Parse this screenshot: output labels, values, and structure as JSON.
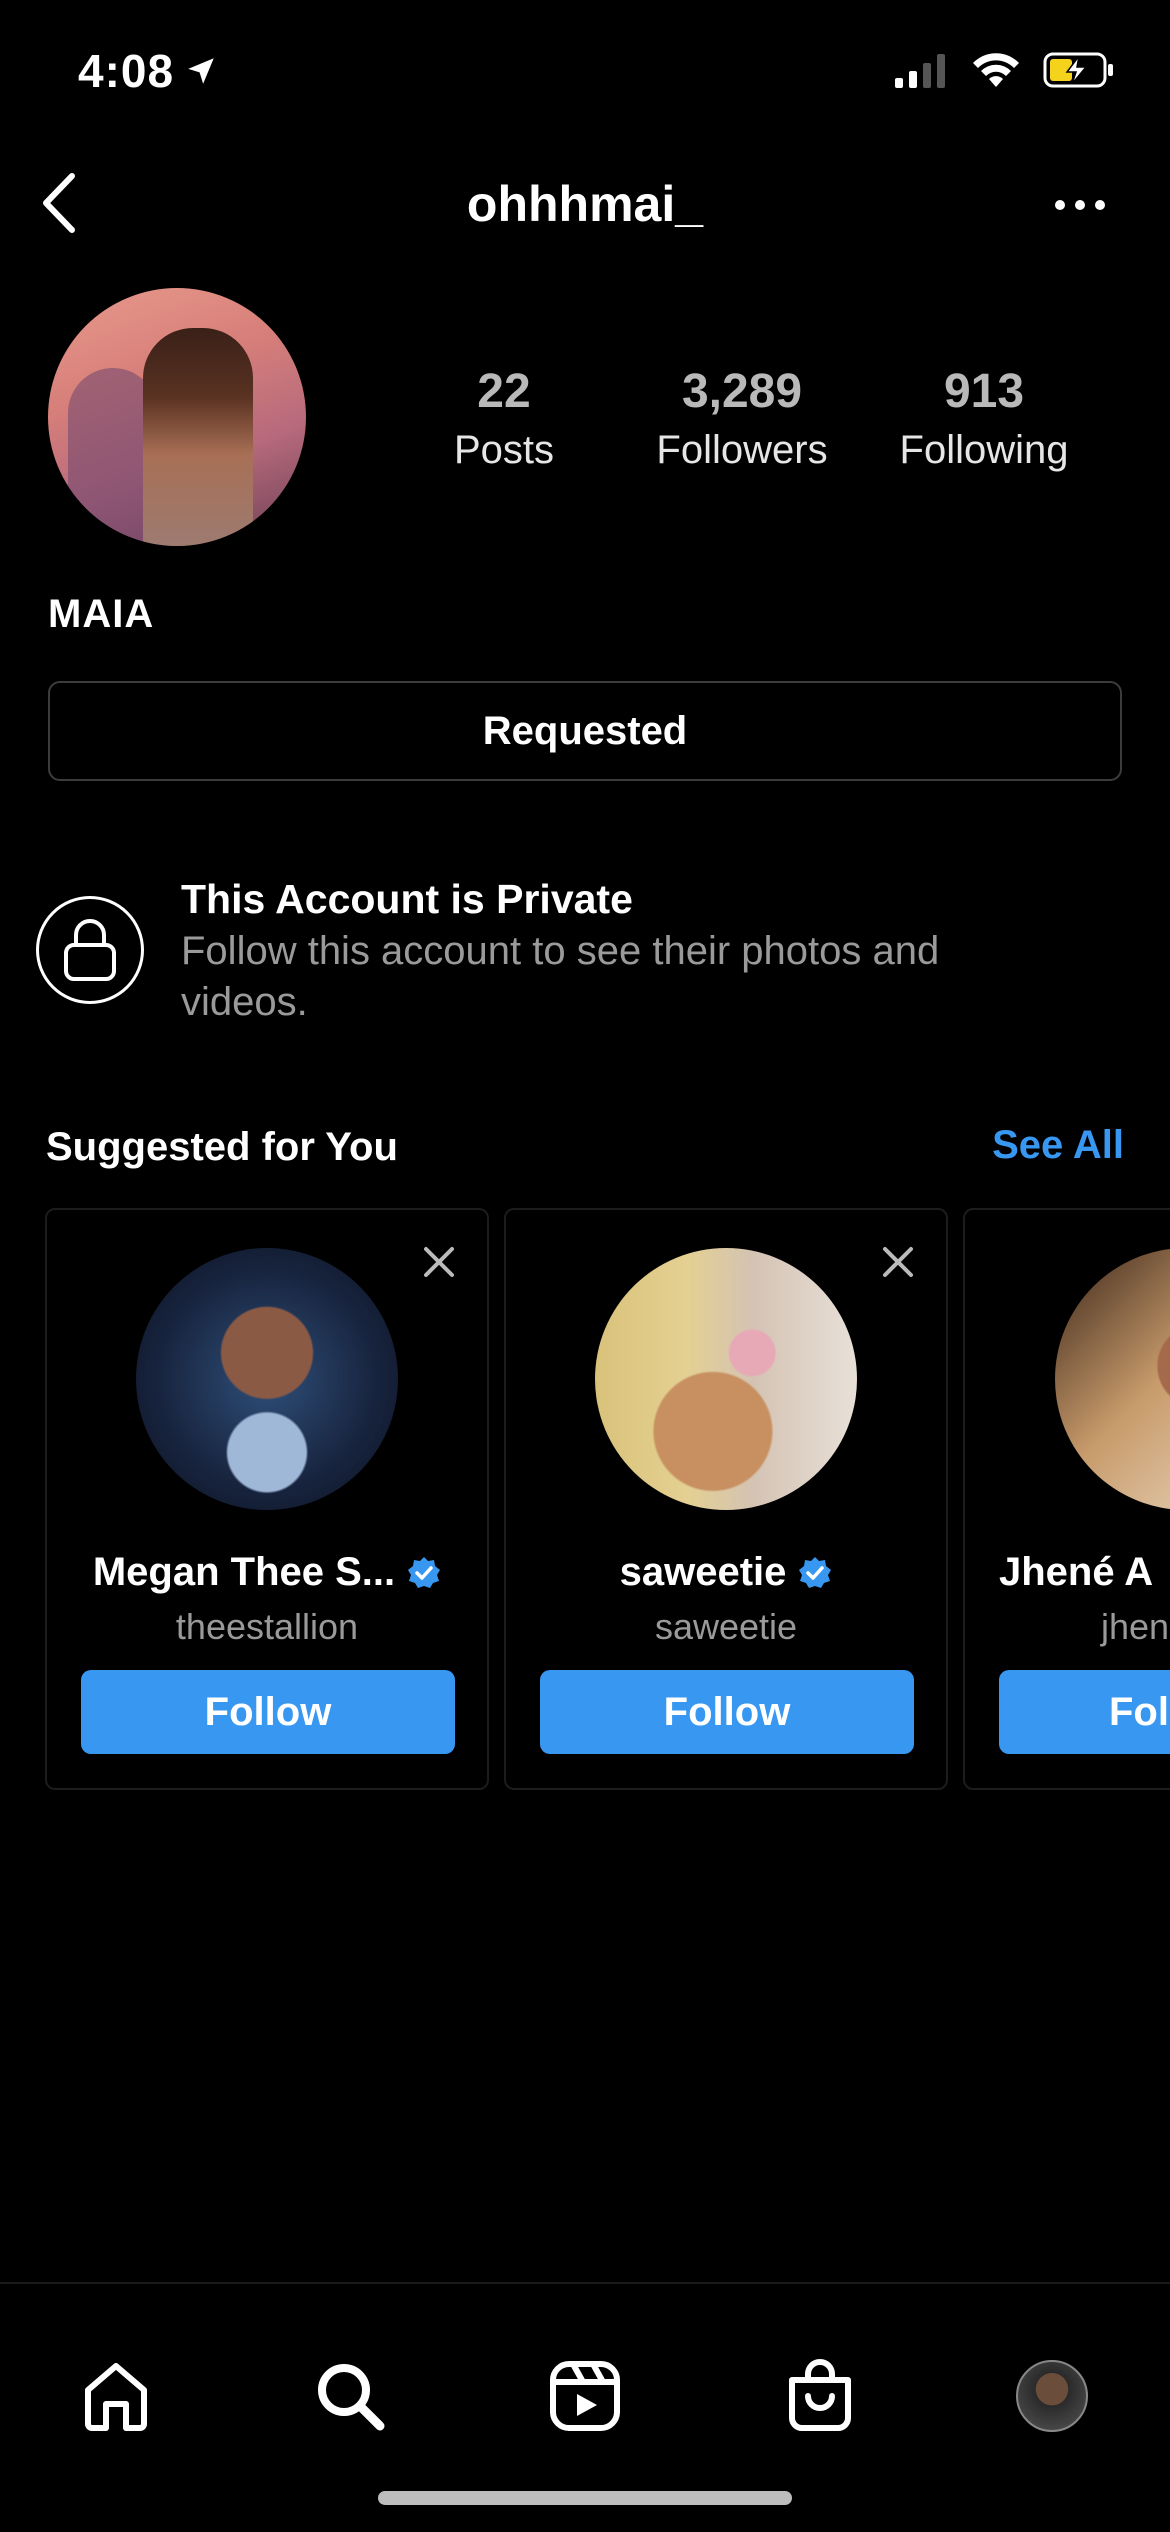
{
  "status_bar": {
    "time": "4:08"
  },
  "header": {
    "username": "ohhhmai_"
  },
  "profile": {
    "display_name": "MAIA",
    "stats": [
      {
        "value": "22",
        "label": "Posts"
      },
      {
        "value": "3,289",
        "label": "Followers"
      },
      {
        "value": "913",
        "label": "Following"
      }
    ],
    "action_button": "Requested"
  },
  "private_notice": {
    "title": "This Account is Private",
    "subtitle": "Follow this account to see their photos and videos."
  },
  "suggested": {
    "title": "Suggested for You",
    "see_all": "See All",
    "cards": [
      {
        "name": "Megan Thee S...",
        "handle": "theestallion",
        "verified": true,
        "button": "Follow"
      },
      {
        "name": "saweetie",
        "handle": "saweetie",
        "verified": true,
        "button": "Follow"
      },
      {
        "name": "Jhené A",
        "handle": "jhen",
        "verified": false,
        "button": "Fol"
      }
    ]
  },
  "tabbar": {
    "items": [
      "home-icon",
      "search-icon",
      "reels-icon",
      "shop-icon",
      "profile-avatar"
    ]
  },
  "colors": {
    "accent": "#3897f0",
    "background": "#000000",
    "verified": "#3897f0"
  }
}
